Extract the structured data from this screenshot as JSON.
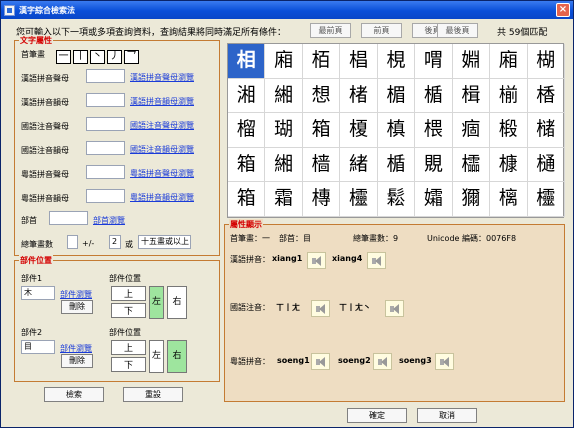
{
  "window": {
    "title": "漢字綜合檢索法",
    "close_label": "×"
  },
  "toolbar": {
    "instruction": "您可輸入以下一項或多項查詢資料，查詢結果將同時滿足所有條件：",
    "first_page": "最前頁",
    "prev_page": "前頁",
    "next_page": "後頁",
    "last_page": "最後頁",
    "match_count": "共 59個匹配"
  },
  "text_attributes": {
    "title": "文字屬性",
    "first_stroke_label": "首筆畫",
    "strokes": [
      "一",
      "丨",
      "丶",
      "丿",
      "乛"
    ],
    "han_initial_label": "漢語拼音聲母",
    "han_initial_value": "",
    "han_initial_link": "漢語拼音聲母瀏覽",
    "han_final_label": "漢語拼音韻母",
    "han_final_value": "",
    "han_final_link": "漢語拼音韻母瀏覽",
    "bopomofo_initial_label": "國語注音聲母",
    "bopomofo_initial_value": "",
    "bopomofo_initial_link": "國語注音聲母瀏覽",
    "bopomofo_final_label": "國語注音韻母",
    "bopomofo_final_value": "",
    "bopomofo_final_link": "國語注音韻母瀏覽",
    "cantonese_initial_label": "粵語拼音聲母",
    "cantonese_initial_value": "",
    "cantonese_initial_link": "粵語拼音聲母瀏覽",
    "cantonese_final_label": "粵語拼音韻母",
    "cantonese_final_value": "",
    "cantonese_final_link": "粵語拼音韻母瀏覽",
    "radical_label": "部首",
    "radical_value": "",
    "radical_link": "部首瀏覽",
    "total_strokes_label": "總筆畫數",
    "total_strokes_value": "",
    "plus_minus_label": "+/-",
    "range_value": "2",
    "or_label": "或",
    "fifteen_label": "十五畫或以上"
  },
  "component_position": {
    "title": "部件位置",
    "component1_label": "部件1",
    "component1_value": "木",
    "component1_browse": "部件瀏覽",
    "component1_delete": "刪除",
    "position1_label": "部件位置",
    "component2_label": "部件2",
    "component2_value": "目",
    "component2_browse": "部件瀏覽",
    "component2_delete": "刪除",
    "position2_label": "部件位置",
    "top": "上",
    "bottom": "下",
    "left": "左",
    "right": "右"
  },
  "results": {
    "characters": [
      [
        "相",
        "廂",
        "栢",
        "椙",
        "梘",
        "喟",
        "婣",
        "廂",
        "楜"
      ],
      [
        "湘",
        "緗",
        "想",
        "楮",
        "楣",
        "楯",
        "楫",
        "椾",
        "楿"
      ],
      [
        "榴",
        "瑚",
        "箱",
        "榎",
        "槙",
        "椳",
        "痼",
        "椴",
        "槠"
      ],
      [
        "箱",
        "緗",
        "樯",
        "緒",
        "楯",
        "覞",
        "櫺",
        "槺",
        "樋"
      ],
      [
        "箱",
        "霜",
        "槫",
        "欞",
        "鬆",
        "孀",
        "獮",
        "樆",
        "欞"
      ]
    ],
    "selected": "相"
  },
  "properties": {
    "title": "屬性顯示",
    "first_stroke": "首筆畫：一",
    "radical": "部首：目",
    "total_strokes": "總筆畫數：9",
    "unicode": "Unicode 編碼：0076F8",
    "hanyu_label": "漢語拼音：",
    "hanyu": [
      "xiang1",
      "xiang4"
    ],
    "bopomofo_label": "國語注音：",
    "bopomofo": [
      "ㄒ丨ㄤ",
      "ㄒ丨ㄤ丶"
    ],
    "jyutping_label": "粵語拼音：",
    "jyutping": [
      "soeng1",
      "soeng2",
      "soeng3"
    ]
  },
  "actions": {
    "search": "檢索",
    "reset": "重設",
    "ok": "確定",
    "cancel": "取消"
  },
  "colors": {
    "title_bar": "#0a4fd8",
    "selected_cell": "#2d64c9",
    "accent_red": "#d40000",
    "highlight_green": "#9ee59e"
  },
  "icons": {
    "app": "app-icon",
    "close": "close-icon",
    "speaker": "speaker-icon"
  }
}
